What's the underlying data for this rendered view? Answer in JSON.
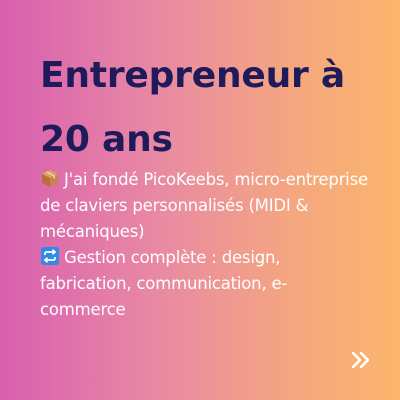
{
  "slide": {
    "title": "Entrepreneur à 20 ans",
    "lines": [
      {
        "icon": "package-icon",
        "text": "J'ai fondé PicoKeebs, micro-entreprise de claviers personnalisés (MIDI & mécaniques)"
      },
      {
        "icon": "repeat-arrows-icon",
        "text": "Gestion complète : design, fabrication, communication, e-commerce"
      }
    ],
    "next_icon": "double-chevron-right-icon"
  },
  "colors": {
    "gradient_start": "#d85fb0",
    "gradient_end": "#fbb56c",
    "title": "#1f1a5a",
    "body_text": "#ffffff",
    "repeat_icon_bg": "#2f8ae8"
  }
}
